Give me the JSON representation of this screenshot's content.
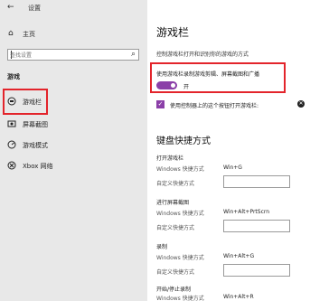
{
  "window": {
    "back_glyph": "←",
    "title": "设置"
  },
  "nav": {
    "home_label": "主页",
    "search_placeholder": "查找设置",
    "section_label": "游戏",
    "items": [
      {
        "label": "游戏栏",
        "icon": "game-bar-icon"
      },
      {
        "label": "屏幕截图",
        "icon": "captures-icon"
      },
      {
        "label": "游戏模式",
        "icon": "game-mode-icon"
      },
      {
        "label": "Xbox 网络",
        "icon": "xbox-icon"
      }
    ],
    "selected_index": 0
  },
  "main": {
    "title": "游戏栏",
    "description": "控制游戏栏打开和识别你的游戏的方式",
    "record_setting": {
      "label": "使用游戏栏录制游戏剪辑、屏幕截图和广播",
      "state_label": "开",
      "on": true
    },
    "controller_setting": {
      "label": "使用控制器上的这个按钮打开游戏栏:",
      "checked": true
    },
    "shortcuts_title": "键盘快捷方式",
    "shortcut_groups": [
      {
        "title": "打开游戏栏",
        "windows_label": "Windows 快捷方式",
        "windows_value": "Win+G",
        "custom_label": "自定义快捷方式"
      },
      {
        "title": "进行屏幕截图",
        "windows_label": "Windows 快捷方式",
        "windows_value": "Win+Alt+PrtScrn",
        "custom_label": "自定义快捷方式"
      },
      {
        "title": "录制",
        "windows_label": "Windows 快捷方式",
        "windows_value": "Win+Alt+G",
        "custom_label": "自定义快捷方式"
      },
      {
        "title": "开始/停止录制",
        "windows_label": "Windows 快捷方式",
        "windows_value": "Win+Alt+R"
      }
    ]
  },
  "colors": {
    "accent": "#8b3fa8",
    "highlight": "#e3242b",
    "sidebar_bg": "#e8e8e8"
  }
}
